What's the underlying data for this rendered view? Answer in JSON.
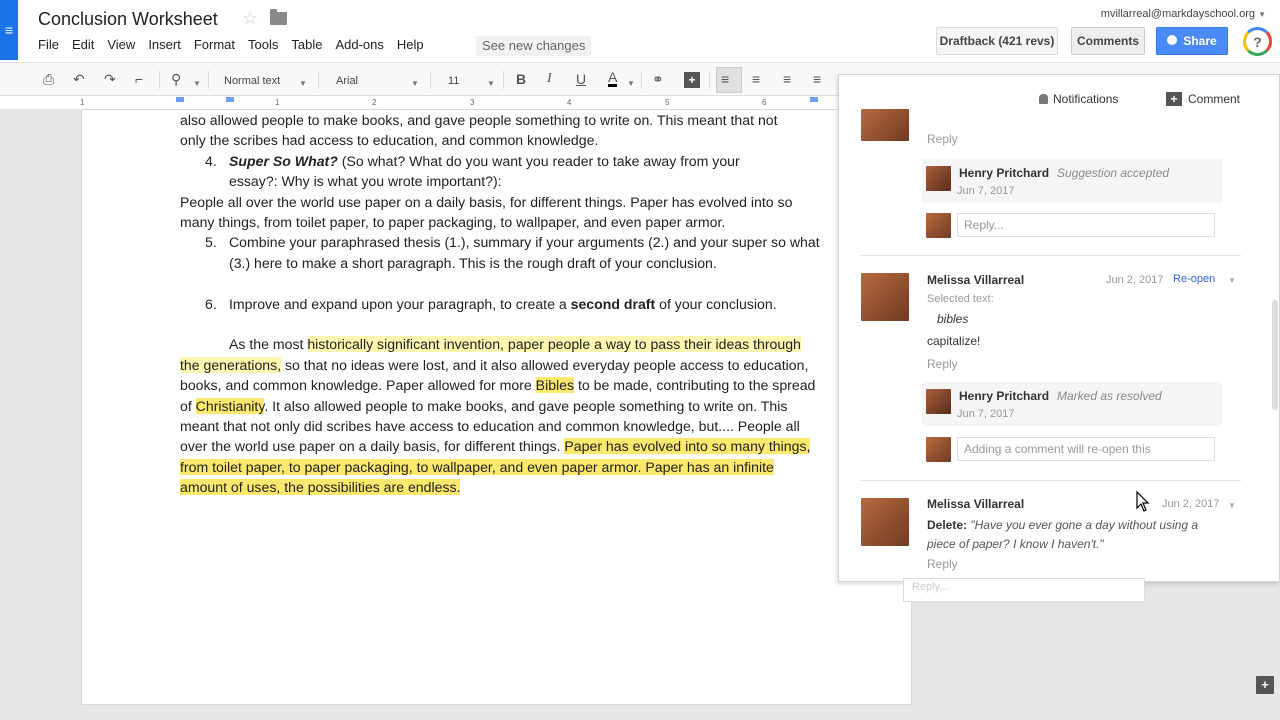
{
  "header": {
    "doc_title": "Conclusion Worksheet",
    "menu": [
      "File",
      "Edit",
      "View",
      "Insert",
      "Format",
      "Tools",
      "Table",
      "Add-ons",
      "Help"
    ],
    "see_changes": "See new changes",
    "user_email": "mvillarreal@markdayschool.org",
    "draftback_label": "Draftback (421 revs)",
    "comments_label": "Comments",
    "share_label": "Share",
    "help_glyph": "?"
  },
  "toolbar": {
    "style_value": "Normal text",
    "font_value": "Arial",
    "size_value": "11"
  },
  "ruler": {
    "numbers": [
      "1",
      "1",
      "2",
      "3",
      "4",
      "5",
      "6"
    ]
  },
  "document": {
    "line_top_cut": "also allowed people to make books, and gave people something to write on. This meant that not",
    "line_top_2": "only the scribes had access to education, and common knowledge.",
    "item4_num": "4.",
    "item4_bold": "Super So What?",
    "item4_rest": " (So what? What do you want you reader to take away from your",
    "item4_line2": "essay?: Why is what you wrote important?):",
    "para_people": "People all over the world use paper on a daily basis, for different things. Paper has evolved into so many things, from toilet paper, to paper packaging, to wallpaper, and even paper armor.",
    "item5_num": "5.",
    "item5_text": "Combine your paraphrased thesis (1.), summary if your arguments (2.) and your super so what (3.) here to make a short paragraph. This is the rough draft of your conclusion.",
    "item6_num": "6.",
    "item6_pre": "Improve and expand upon your paragraph, to create a ",
    "item6_bold": "second draft",
    "item6_post": " of your conclusion.",
    "final_p1": "As the most ",
    "final_hl1": "historically significant invention, paper people a way to pass their ideas through the generations,",
    "final_p2": " so that no ideas were lost, and it also allowed everyday people access to education, books, and common knowledge. Paper allowed for more ",
    "final_hl2": "Bibles",
    "final_p3": " to be made, contributing to the spread of ",
    "final_hl3": "Christianity",
    "final_p4": ". It also allowed people to make books, and gave people something to write on. This meant that not only did  scribes have access to education and common knowledge, but.... People all over the world use paper on a daily basis, for different things. ",
    "final_hl4": "Paper has evolved into so many things, from toilet paper, to paper packaging, to wallpaper, and even paper armor. Paper has an infinite amount of uses, the possibilities are endless."
  },
  "comments_panel": {
    "notifications_label": "Notifications",
    "comment_label": "Comment",
    "thread0": {
      "reply_link": "Reply",
      "sub_name": "Henry Pritchard",
      "sub_status": "Suggestion accepted",
      "sub_date": "Jun 7, 2017",
      "reply_placeholder": "Reply..."
    },
    "thread1": {
      "name": "Melissa Villarreal",
      "date": "Jun 2, 2017",
      "reopen": "Re-open",
      "selected_label": "Selected text:",
      "selected_text": "bibles",
      "comment": "capitalize!",
      "reply_link": "Reply",
      "sub_name": "Henry Pritchard",
      "sub_status": "Marked as resolved",
      "sub_date": "Jun 7, 2017",
      "reply_placeholder": "Adding a comment will re-open this"
    },
    "thread2": {
      "name": "Melissa Villarreal",
      "date": "Jun 2, 2017",
      "label": "Delete:",
      "text": "\"Have you ever gone a day without using a piece of paper? I know I haven't.\"",
      "reply_link": "Reply"
    },
    "below_reply": "Reply..."
  },
  "icons": [
    "hamburger-icon",
    "star-icon",
    "folder-icon",
    "print-icon",
    "undo-icon",
    "redo-icon",
    "paint-format-icon",
    "zoom-icon",
    "bold-icon",
    "italic-icon",
    "underline-icon",
    "text-color-icon",
    "link-icon",
    "insert-comment-icon",
    "align-left-icon",
    "align-center-icon",
    "align-right-icon",
    "justify-icon",
    "bell-icon",
    "plus-icon",
    "add-comment-icon"
  ],
  "colors": {
    "accent": "#4a8af4",
    "highlight": "#fce86c",
    "link": "#3367d6"
  }
}
